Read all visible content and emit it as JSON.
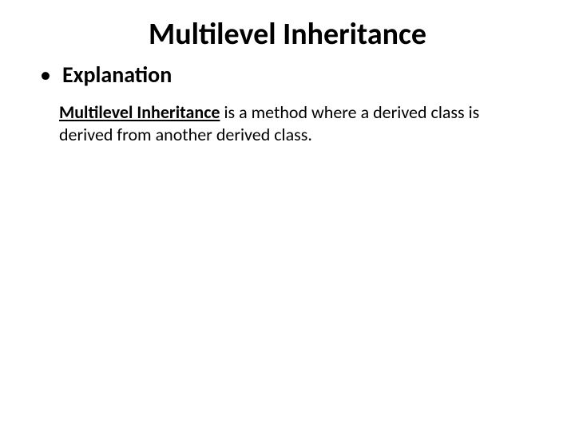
{
  "title": "Multilevel Inheritance",
  "bullet": {
    "label": "Explanation"
  },
  "body": {
    "leading_space": " ",
    "term": "Multilevel Inheritance",
    "definition_part1": " is a method where a derived class is derived from another derived class."
  }
}
